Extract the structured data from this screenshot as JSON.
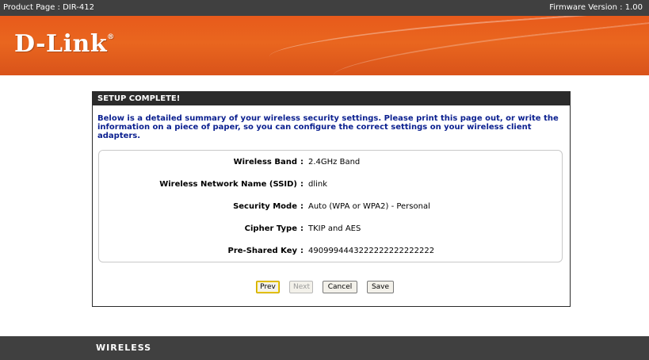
{
  "topbar": {
    "product_page": "Product Page : DIR-412",
    "firmware": "Firmware Version : 1.00"
  },
  "brand": {
    "logo_text": "D-Link",
    "reg": "®"
  },
  "panel": {
    "title": "SETUP COMPLETE!",
    "intro": "Below is a detailed summary of your wireless security settings. Please print this page out, or write the information on a piece of paper, so you can configure the correct settings on your wireless client adapters.",
    "rows": [
      {
        "label": "Wireless Band",
        "value": "2.4GHz Band"
      },
      {
        "label": "Wireless Network Name (SSID)",
        "value": "dlink"
      },
      {
        "label": "Security Mode",
        "value": "Auto (WPA or WPA2) - Personal"
      },
      {
        "label": "Cipher Type",
        "value": "TKIP and AES"
      },
      {
        "label": "Pre-Shared Key",
        "value": "4909994443222222222222222"
      }
    ],
    "colon": ":"
  },
  "buttons": {
    "prev": "Prev",
    "next": "Next",
    "cancel": "Cancel",
    "save": "Save"
  },
  "footer": {
    "label": "WIRELESS"
  },
  "colors": {
    "brand_orange": "#e9661f",
    "dark_bar": "#404040",
    "intro_blue": "#0a1f8f"
  }
}
